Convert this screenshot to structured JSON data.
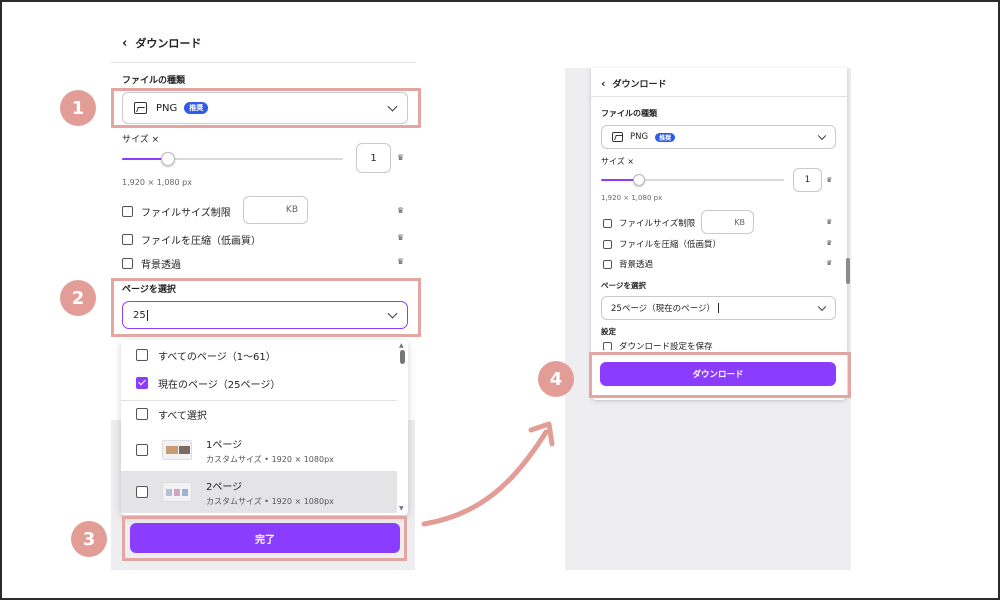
{
  "left": {
    "back_title": "ダウンロード",
    "file_type_label": "ファイルの種類",
    "file_type_value": "PNG",
    "recommended_badge": "推奨",
    "size_label": "サイズ ×",
    "size_value": "1",
    "dimensions": "1,920 × 1,080 px",
    "option_filesize": "ファイルサイズ制限",
    "filesize_unit": "KB",
    "option_compress": "ファイルを圧縮（低画質）",
    "option_transparent": "背景透過",
    "page_select_label": "ページを選択",
    "page_input_value": "25",
    "dropdown": {
      "all_pages": "すべてのページ（1～61）",
      "current_page": "現在のページ（25ページ）",
      "select_all": "すべて選択",
      "pages": [
        {
          "title": "1ページ",
          "subtitle": "カスタムサイズ • 1920 × 1080px"
        },
        {
          "title": "2ページ",
          "subtitle": "カスタムサイズ • 1920 × 1080px"
        }
      ]
    },
    "done_button": "完了"
  },
  "right": {
    "back_title": "ダウンロード",
    "file_type_label": "ファイルの種類",
    "file_type_value": "PNG",
    "recommended_badge": "推奨",
    "size_label": "サイズ ×",
    "size_value": "1",
    "dimensions": "1,920 × 1,080 px",
    "option_filesize": "ファイルサイズ制限",
    "filesize_unit": "KB",
    "option_compress": "ファイルを圧縮（低画質）",
    "option_transparent": "背景透過",
    "page_select_label": "ページを選択",
    "page_select_value": "25ページ（現在のページ）",
    "settings_label": "設定",
    "save_settings": "ダウンロード設定を保存",
    "download_button": "ダウンロード"
  },
  "steps": [
    "1",
    "2",
    "3",
    "4"
  ],
  "slider_level": 0.21,
  "colors": {
    "accent": "#8b3dff",
    "badge": "#2e5be8",
    "highlight": "#e4a6a2",
    "step_circle": "#e29e96"
  },
  "icons": [
    "back-chevron-icon",
    "image-icon",
    "chevron-down-icon",
    "crown-icon",
    "checkbox-icon",
    "check-icon",
    "curved-arrow-icon"
  ]
}
